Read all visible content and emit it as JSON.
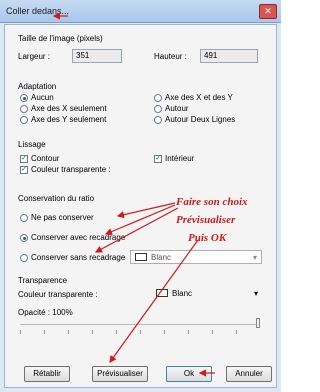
{
  "window": {
    "title": "Coller dedans...",
    "close_glyph": "✕"
  },
  "image_size": {
    "label": "Taille de l'image (pixels)",
    "width_label": "Largeur :",
    "width_value": "351",
    "height_label": "Hauteur :",
    "height_value": "491"
  },
  "adaptation": {
    "label": "Adaptation",
    "options": [
      "Aucun",
      "Axe des X et des Y",
      "Axe des X seulement",
      "Autour",
      "Axe des Y seulement",
      "Autour Deux Lignes"
    ],
    "selected": "Aucun"
  },
  "lissage": {
    "label": "Lissage",
    "contour": "Contour",
    "interieur": "Intérieur",
    "couleur_transparente": "Couleur transparente :"
  },
  "ratio": {
    "label": "Conservation du ratio",
    "ne_pas_conserver": "Ne pas conserver",
    "conserver_avec": "Conserver avec recadrage",
    "conserver_sans": "Conserver sans recadrage",
    "selected": "Conserver avec recadrage",
    "color_value": "Blanc"
  },
  "transparence": {
    "label": "Transparence",
    "couleur_label": "Couleur transparente :",
    "couleur_value": "Blanc",
    "opacite": "Opacité : 100%",
    "opacity_level": 100
  },
  "buttons": {
    "retablir": "Rétablir",
    "previsualiser": "Prévisualiser",
    "ok": "Ok",
    "annuler": "Annuler"
  },
  "annotation": {
    "line1": "Faire son choix",
    "line2": "Prévisualiser",
    "line3": "Puis OK",
    "color": "#d11a1a"
  }
}
